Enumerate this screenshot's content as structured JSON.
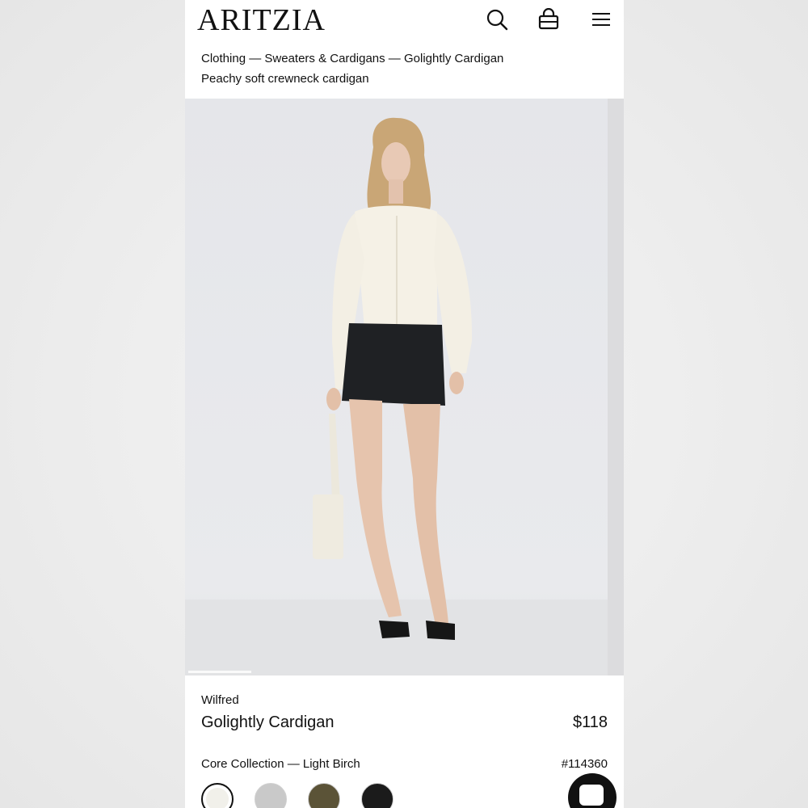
{
  "header": {
    "logo": "ARITZIA",
    "icons": [
      "search-icon",
      "shopping-bag-icon",
      "menu-icon"
    ]
  },
  "breadcrumb": {
    "items": [
      "Clothing",
      "Sweaters & Cardigans",
      "Golightly Cardigan"
    ],
    "separator": " — "
  },
  "product": {
    "tagline": "Peachy soft crewneck cardigan",
    "brand": "Wilfred",
    "name": "Golightly Cardigan",
    "price": "$118",
    "collection": "Core Collection — Light Birch",
    "sku": "#114360"
  },
  "gallery": {
    "progress": 0.15
  },
  "swatches": [
    {
      "name": "Light Birch",
      "color": "#f1f0ea",
      "selected": true
    },
    {
      "name": "Grey",
      "color": "#c9c9c9",
      "selected": false
    },
    {
      "name": "Olive",
      "color": "#5b5337",
      "selected": false
    },
    {
      "name": "Black",
      "color": "#1b1b1b",
      "selected": false
    }
  ],
  "colors": {
    "text": "#111111",
    "background": "#ffffff",
    "hero_bg": "#e6e7ea"
  }
}
